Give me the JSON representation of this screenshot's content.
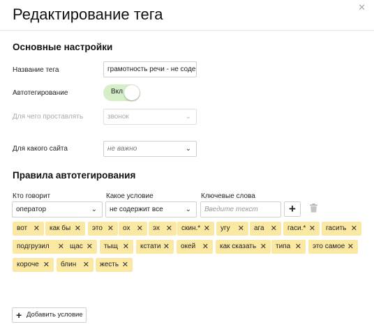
{
  "dialog": {
    "title": "Редактирование тега"
  },
  "basic": {
    "section_title": "Основные настройки",
    "name_label": "Название тега",
    "name_value": "грамотность речи - не содержит",
    "autotag_label": "Автотегирование",
    "autotag_toggle_label": "Вкл",
    "autotag_on": true,
    "apply_for_label": "Для чего проставлять",
    "apply_for_value": "звонок",
    "site_label": "Для какого сайта",
    "site_value": "не важно"
  },
  "rules": {
    "section_title": "Правила автотегирования",
    "speaker_label": "Кто говорит",
    "speaker_value": "оператор",
    "condition_label": "Какое условие",
    "condition_value": "не содержит все",
    "keywords_label": "Ключевые слова",
    "keywords_placeholder": "Введите текст",
    "keywords": [
      "вот",
      "как бы",
      "это",
      "ох",
      "эх",
      "скин.*",
      "угу",
      "ага",
      "гаси.*",
      "гасить",
      "подгрузил",
      "щас",
      "тыщ",
      "кстати",
      "окей",
      "как сказать",
      "типа",
      "это самое",
      "короче",
      "блин",
      "жесть"
    ]
  },
  "footer": {
    "add_condition_label": "Добавить условие"
  }
}
